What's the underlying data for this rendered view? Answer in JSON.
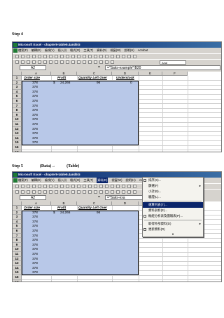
{
  "steps": [
    {
      "label": "Step 4"
    },
    {
      "label": "Step 5",
      "data": "(Data)",
      "arrow": "→",
      "target": "(Table)"
    }
  ],
  "app": {
    "title": "Microsoft Excel - chapter9-table9.4and9.5"
  },
  "menu": [
    "檔案(F)",
    "編輯(E)",
    "檢視(V)",
    "插入(I)",
    "格式(O)",
    "工具(T)",
    "資料(D)",
    "視窗(W)",
    "說明(H)",
    "Acrobat"
  ],
  "toolbar": {
    "font": "Arial",
    "zoom": "100%"
  },
  "shot1": {
    "namebox": "A2",
    "formula": "=\"Saks-example\"!B20"
  },
  "shot2": {
    "namebox": "A2",
    "formula": "=\"Saks-exa"
  },
  "columns": [
    "A",
    "B",
    "C",
    "D",
    "E",
    "F"
  ],
  "headers": {
    "order_size": "Order size",
    "profit": "Profit",
    "qty": "Quantity Left Over",
    "under": "Understock"
  },
  "first_row": {
    "order": "378",
    "currency": "$",
    "profit": "24,266",
    "qty": "96",
    "under": "0"
  },
  "order_values": [
    "378",
    "378",
    "378",
    "378",
    "378",
    "378",
    "378",
    "378",
    "378",
    "378",
    "378",
    "378",
    "378",
    "378"
  ],
  "rows1": [
    "1",
    "2",
    "3",
    "4",
    "5",
    "6",
    "7",
    "8",
    "9",
    "10",
    "11",
    "12",
    "13",
    "14",
    "15",
    "16",
    "17"
  ],
  "rows2": [
    "1",
    "2",
    "3",
    "4",
    "5",
    "6",
    "7",
    "8",
    "9",
    "10",
    "11",
    "12",
    "13",
    "14",
    "15",
    "16",
    "17",
    "18",
    "19"
  ],
  "data_menu": [
    {
      "label": "排序(S)...",
      "icon": "sort-icon"
    },
    {
      "label": "篩選(F)",
      "submenu": true
    },
    {
      "label": "小計(B)..."
    },
    {
      "label": "驗證(L)..."
    },
    {
      "sep": true
    },
    {
      "label": "運算列表(T)...",
      "highlight": true
    },
    {
      "label": "資料剖析(E)..."
    },
    {
      "label": "樞紐分析表及圖報表(P)...",
      "icon": "pivot-icon"
    },
    {
      "sep": true
    },
    {
      "label": "取得外部資料(D)",
      "submenu": true
    },
    {
      "label": "更新資料(R)",
      "icon": "refresh-icon"
    }
  ]
}
